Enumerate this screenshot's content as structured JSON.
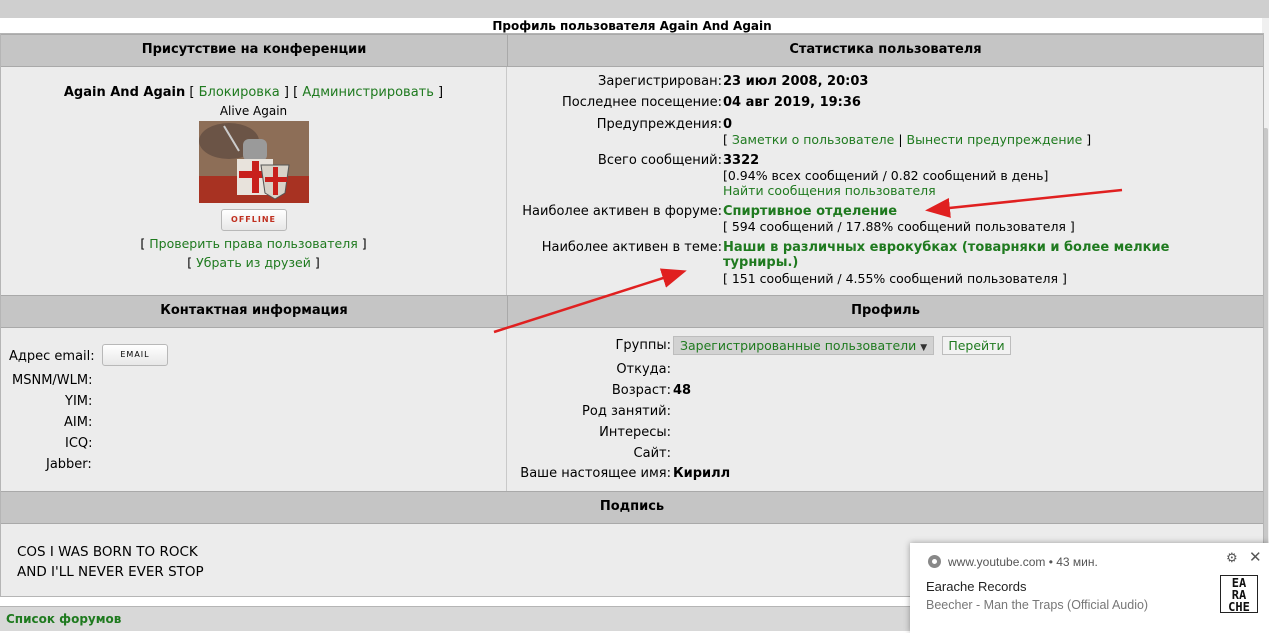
{
  "page_title": "Профиль пользователя Again And Again",
  "headers": {
    "presence": "Присутствие на конференции",
    "stats": "Статистика пользователя",
    "contacts": "Контактная информация",
    "profile": "Профиль",
    "signature": "Подпись"
  },
  "user": {
    "name": "Again And Again",
    "block_link": "Блокировка",
    "admin_link": "Администрировать",
    "title": "Alive Again",
    "status": "OFFLINE",
    "check_rights": "Проверить права пользователя",
    "remove_friend": "Убрать из друзей"
  },
  "stats": {
    "registered_label": "Зарегистрирован:",
    "registered_value": "23 июл 2008, 20:03",
    "last_visit_label": "Последнее посещение:",
    "last_visit_value": "04 авг 2019, 19:36",
    "warnings_label": "Предупреждения:",
    "warnings_value": "0",
    "notes_link": "Заметки о пользователе",
    "warn_link": "Вынести предупреждение",
    "posts_label": "Всего сообщений:",
    "posts_value": "3322",
    "posts_detail": "[0.94% всех сообщений / 0.82 сообщений в день]",
    "find_posts": "Найти сообщения пользователя",
    "active_forum_label": "Наиболее активен в форуме:",
    "active_forum_value": "Спиртивное отделение",
    "active_forum_detail": "[ 594 сообщений / 17.88% сообщений пользователя ]",
    "active_topic_label": "Наиболее активен в теме:",
    "active_topic_value_1": "Наши в различных еврокубках (товарняки и более мелкие",
    "active_topic_value_2": "турниры.)",
    "active_topic_detail": "[ 151 сообщений / 4.55% сообщений пользователя ]"
  },
  "contacts": {
    "email_label": "Адрес email:",
    "email_button": "EMAIL",
    "msnm_label": "MSNM/WLM:",
    "yim_label": "YIM:",
    "aim_label": "AIM:",
    "icq_label": "ICQ:",
    "jabber_label": "Jabber:"
  },
  "profile": {
    "groups_label": "Группы:",
    "groups_value": "Зарегистрированные пользователи",
    "go_button": "Перейти",
    "from_label": "Откуда:",
    "age_label": "Возраст:",
    "age_value": "48",
    "occupation_label": "Род занятий:",
    "interests_label": "Интересы:",
    "site_label": "Сайт:",
    "realname_label": "Ваше настоящее имя:",
    "realname_value": "Кирилл"
  },
  "signature": {
    "line1": "COS I WAS BORN TO ROCK",
    "line2": "AND I'LL NEVER EVER STOP"
  },
  "footer": {
    "forum_list": "Список форумов"
  },
  "notification": {
    "source": "www.youtube.com • 43 мин.",
    "title": "Earache Records",
    "message": "Beecher - Man the Traps (Official Audio)",
    "logo_line1": "EA",
    "logo_line2": "RA",
    "logo_line3": "CHE"
  },
  "colors": {
    "link": "#1f7a1f",
    "header_bg": "#c5c5c5",
    "panel_bg": "#ececec",
    "arrow": "#e02020"
  }
}
